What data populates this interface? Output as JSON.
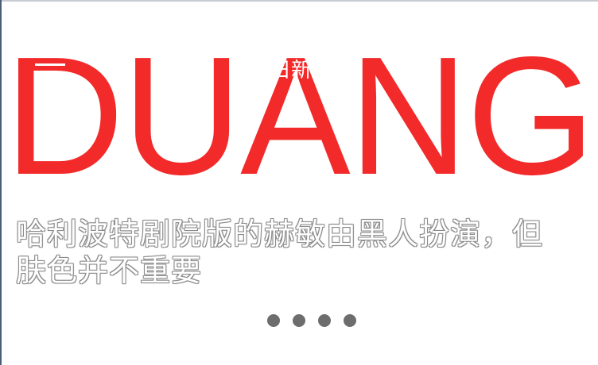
{
  "banner": {
    "image_text": "DUANG",
    "header_title": "日新",
    "menu_icon": "menu-icon"
  },
  "article": {
    "caption": "哈利波特剧院版的赫敏由黑人扮演，但肤色并不重要"
  },
  "carousel": {
    "page_count": 4
  },
  "colors": {
    "banner_text": "#f22a2a",
    "indicator_dot": "#6d6d6d",
    "caption_text": "#ffffff"
  }
}
